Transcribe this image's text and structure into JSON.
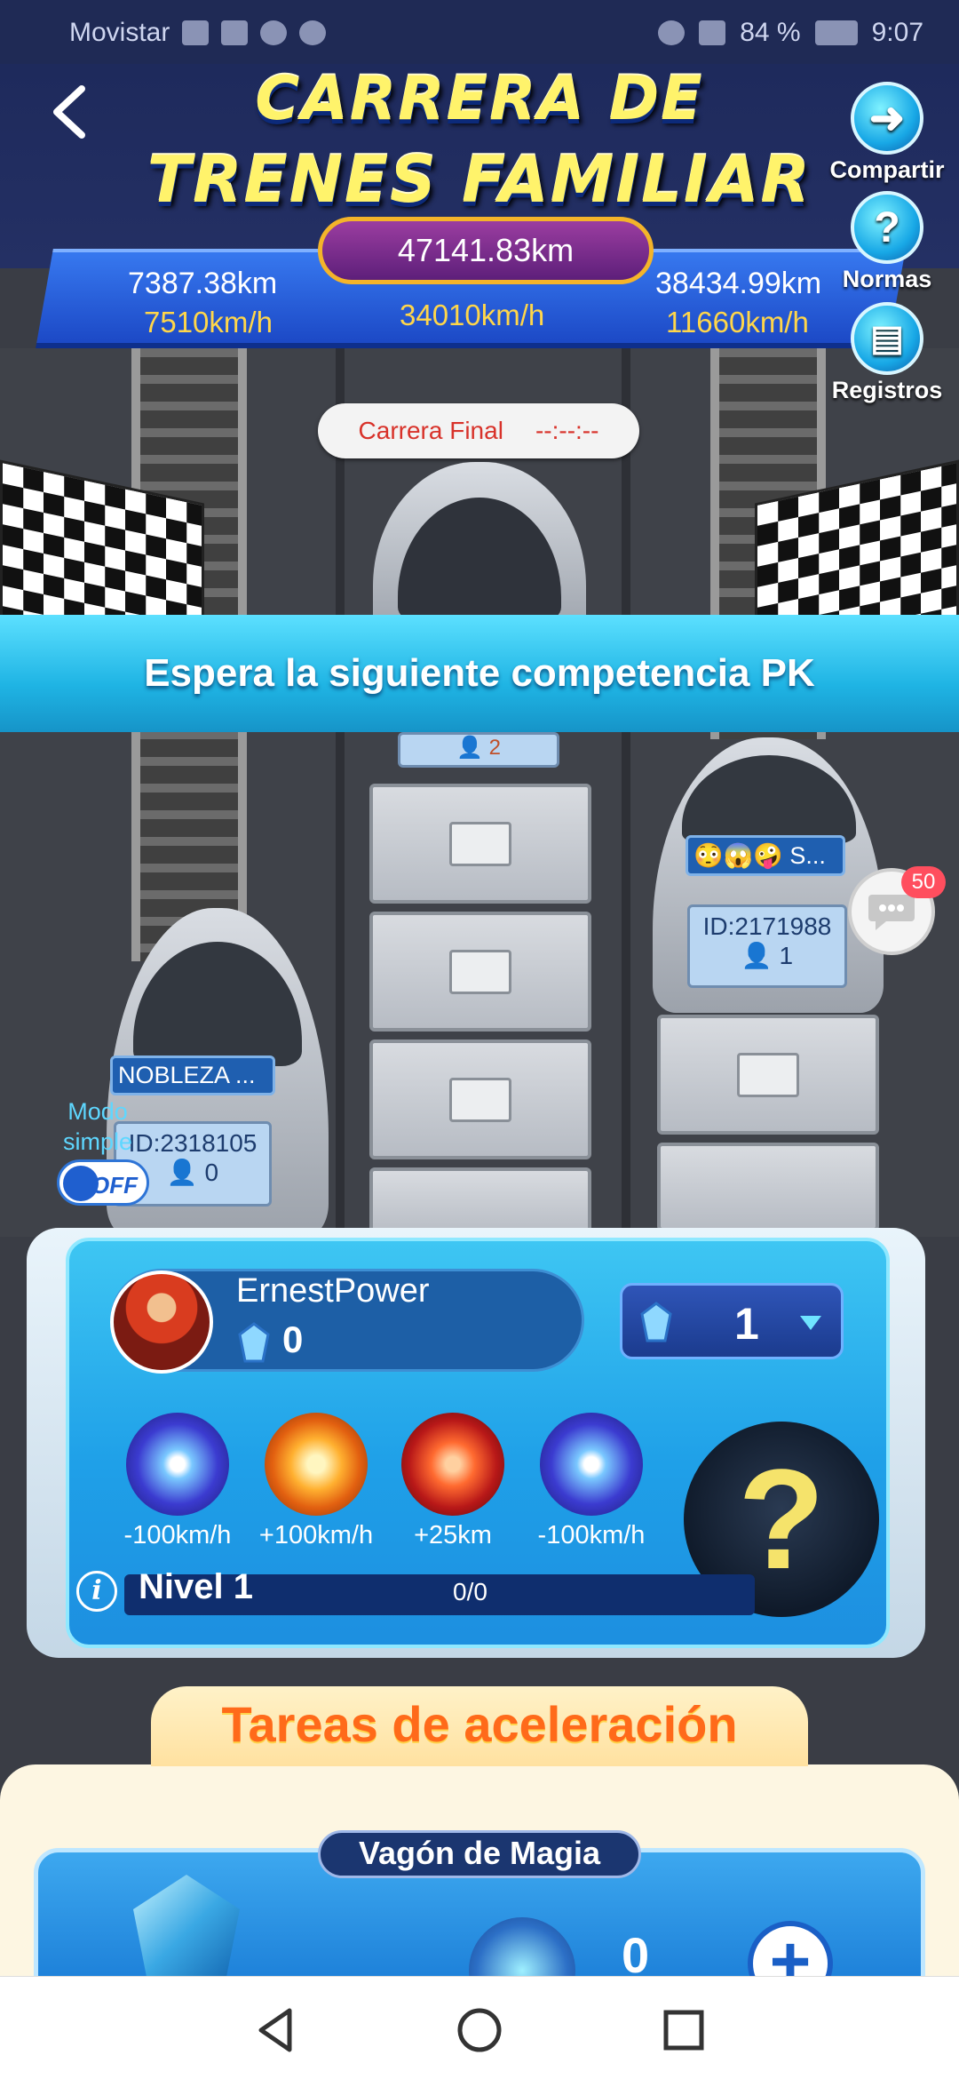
{
  "status_bar": {
    "carrier": "Movistar",
    "battery": "84 %",
    "time": "9:07"
  },
  "header": {
    "title_line1": "CARRERA DE",
    "title_line2": "TRENES FAMILIAR",
    "title_color": "#fff36b"
  },
  "side_buttons": {
    "share": "Compartir",
    "rules": "Normas",
    "records": "Registros"
  },
  "race": {
    "total_distance": "47141.83km",
    "left": {
      "distance": "7387.38km",
      "speed": "7510km/h"
    },
    "center": {
      "speed": "34010km/h"
    },
    "right": {
      "distance": "38434.99km",
      "speed": "11660km/h"
    },
    "final": {
      "label": "Carrera Final",
      "countdown": "--:--:--"
    }
  },
  "banner": "Espera la siguiente competencia PK",
  "trains": {
    "center_members": "2",
    "right": {
      "name": "😳😱🤪 S...",
      "id": "ID:2171988",
      "members": "1"
    },
    "left": {
      "name": "NOBLEZA ...",
      "id": "ID:2318105",
      "members": "0"
    }
  },
  "chat": {
    "badge": "50"
  },
  "simple_mode": {
    "label": "Modo simple",
    "state": "OFF"
  },
  "user": {
    "name": "ErnestPower",
    "gems": "0",
    "gem_select_value": "1",
    "powers": [
      {
        "label": "-100km/h",
        "icon": "blue-star-burst-icon"
      },
      {
        "label": "+100km/h",
        "icon": "orange-burst-icon"
      },
      {
        "label": "+25km",
        "icon": "red-tornado-icon"
      },
      {
        "label": "-100km/h",
        "icon": "blue-star-burst-icon"
      }
    ],
    "mystery": "?",
    "level": "Nivel 1",
    "level_progress": "0/0"
  },
  "tasks": {
    "title": "Tareas de aceleración",
    "magic_wagon": "Vagón de Magia",
    "magic_count": "0"
  },
  "colors": {
    "accent_blue": "#1fa0e8",
    "banner": "#1fb4e4",
    "speed_yellow": "#ffd64a",
    "task_orange": "#ff6a1a"
  }
}
